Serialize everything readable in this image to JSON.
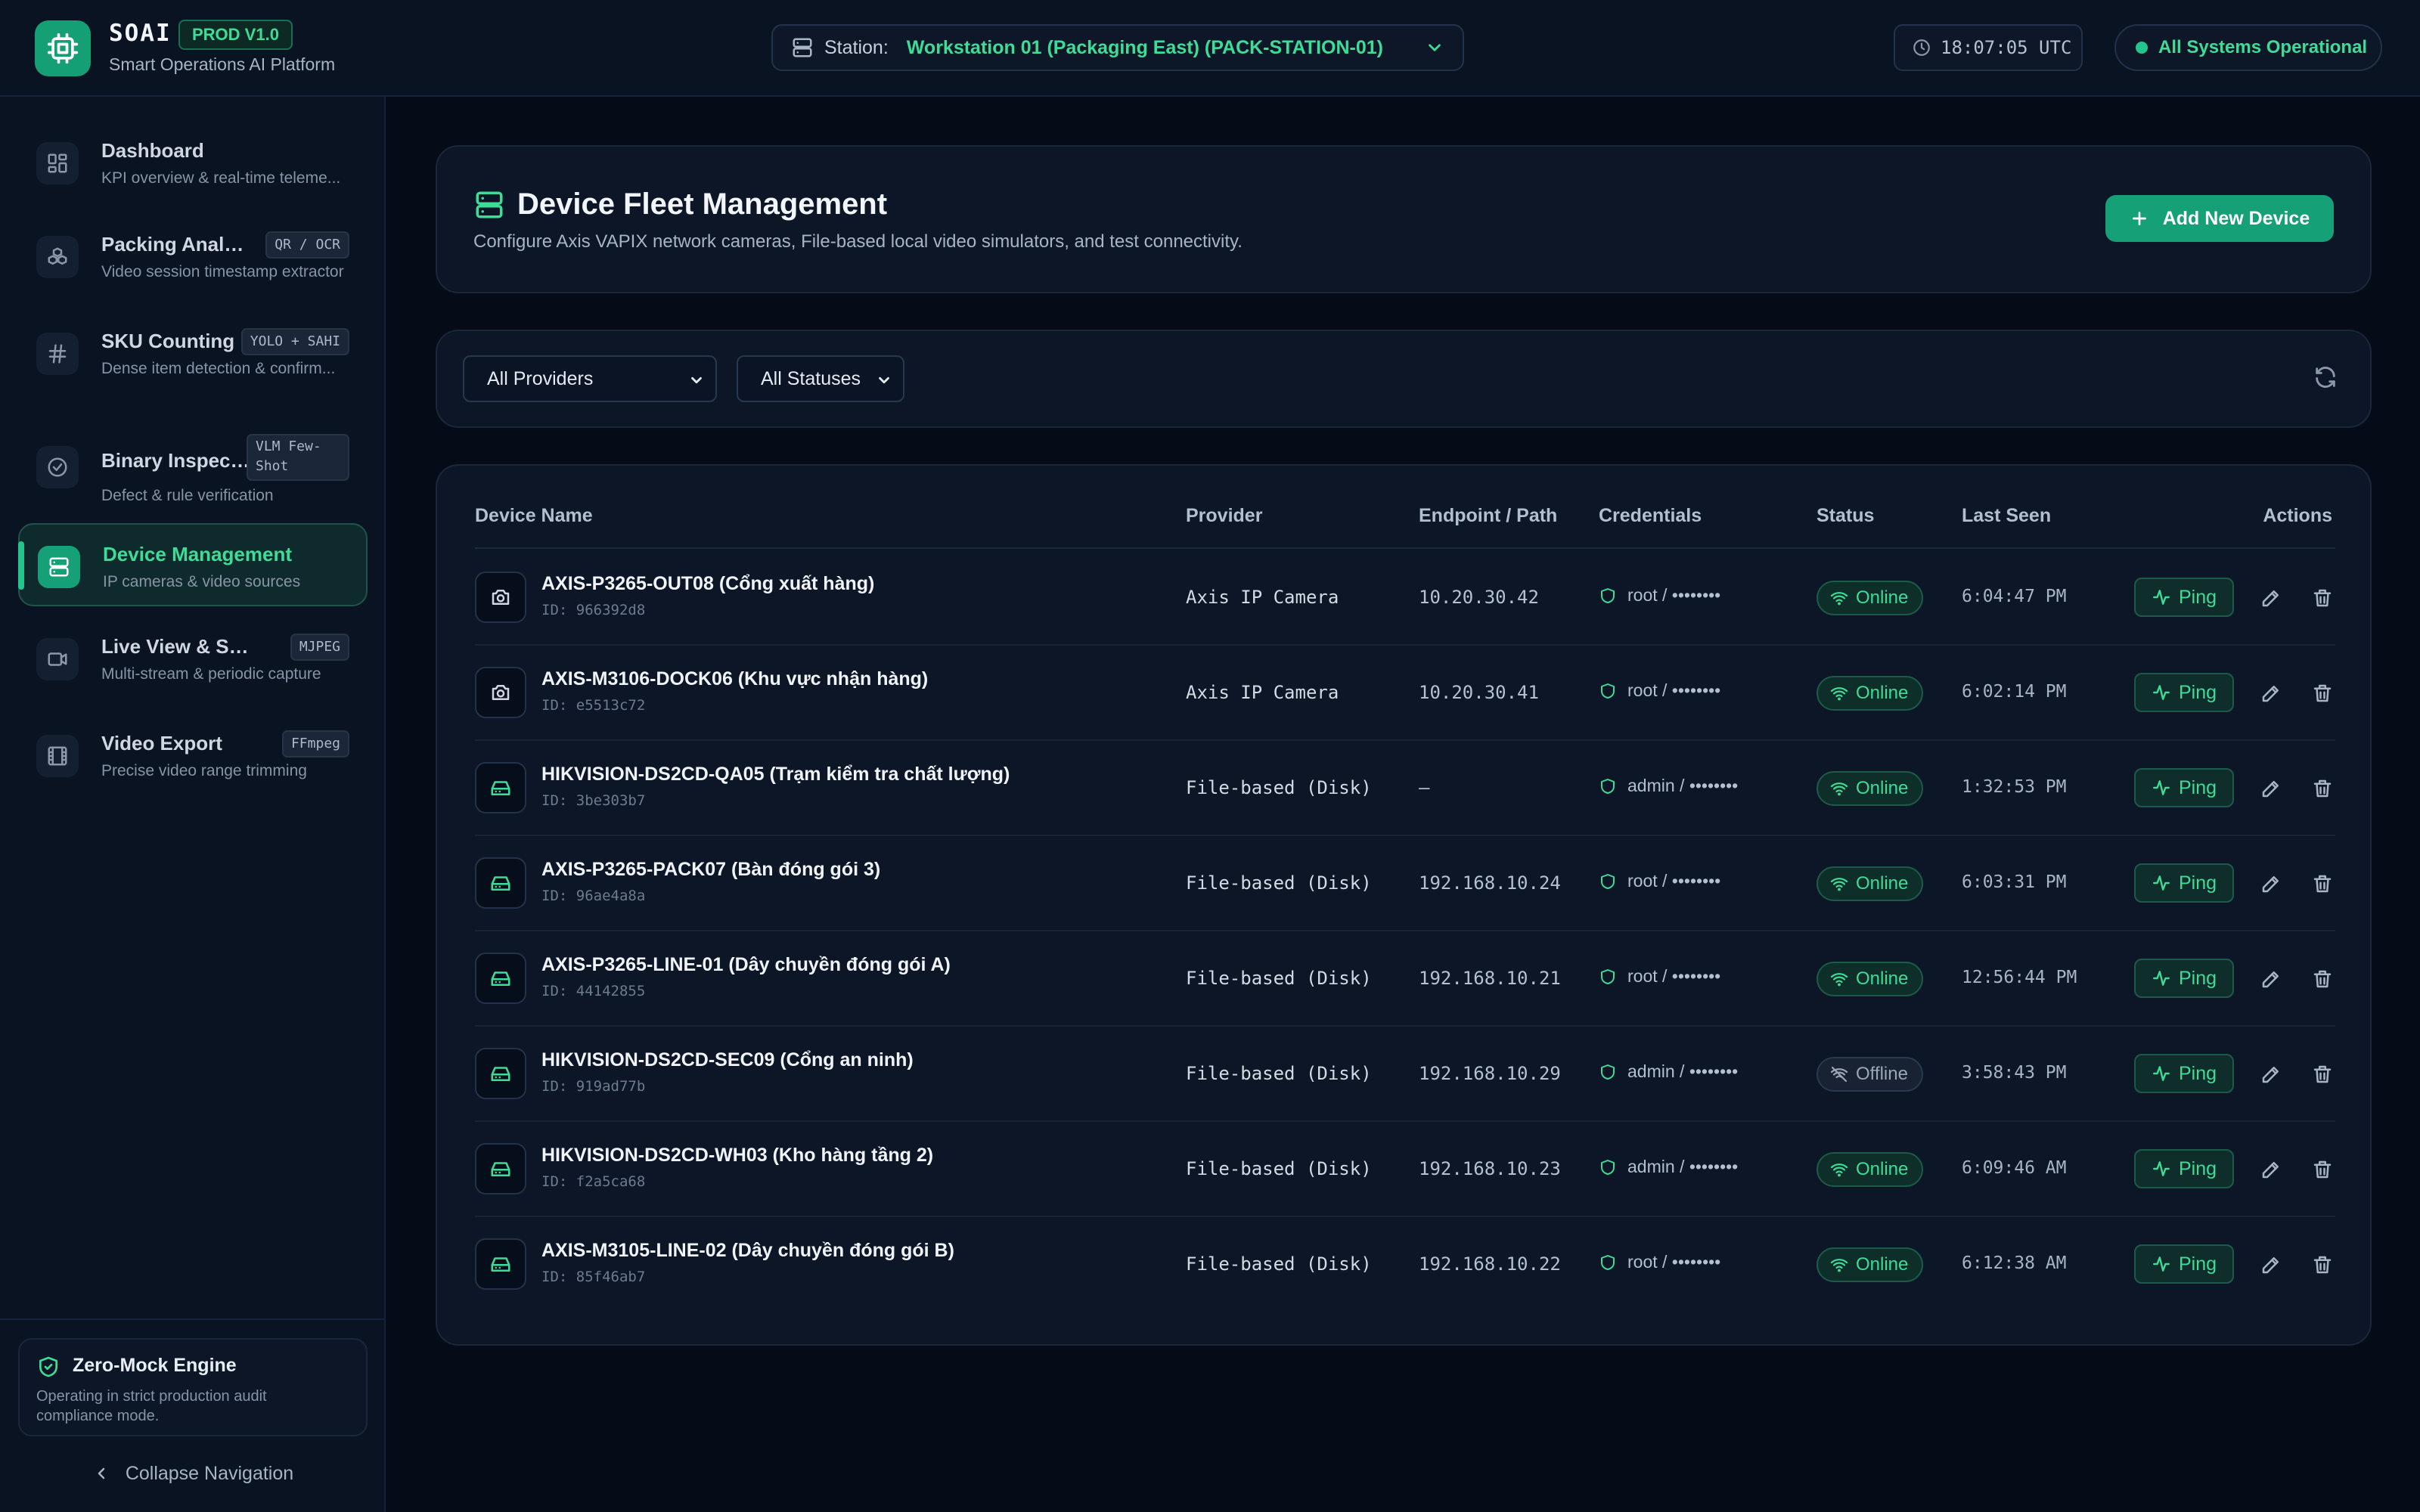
{
  "header": {
    "brand": "SOAI",
    "badge": "PROD V1.0",
    "tagline": "Smart Operations AI Platform",
    "station_label": "Station:",
    "station_value": "Workstation 01 (Packaging East) (PACK-STATION-01)",
    "clock": "18:07:05 UTC",
    "system_status": "All Systems Operational"
  },
  "sidebar": {
    "items": [
      {
        "title": "Dashboard",
        "subtitle": "KPI overview & real-time teleme...",
        "badge": "",
        "icon": "dashboard-grid-icon"
      },
      {
        "title": "Packing Analysis",
        "subtitle": "Video session timestamp extractor",
        "badge": "QR / OCR",
        "icon": "boxes-icon"
      },
      {
        "title": "SKU Counting",
        "subtitle": "Dense item detection & confirm...",
        "badge": "YOLO + SAHI",
        "icon": "hash-icon"
      },
      {
        "title": "Binary Inspect...",
        "subtitle": "Defect & rule verification",
        "badge": "VLM Few-Shot",
        "icon": "check-circle-icon"
      },
      {
        "title": "Device Management",
        "subtitle": "IP cameras & video sources",
        "badge": "",
        "icon": "server-icon"
      },
      {
        "title": "Live View & Snapsh...",
        "subtitle": "Multi-stream & periodic capture",
        "badge": "MJPEG",
        "icon": "video-icon"
      },
      {
        "title": "Video Export",
        "subtitle": "Precise video range trimming",
        "badge": "FFmpeg",
        "icon": "film-icon"
      }
    ],
    "footer": {
      "title": "Zero-Mock Engine",
      "description": "Operating in strict production audit compliance mode.",
      "collapse_label": "Collapse Navigation"
    }
  },
  "main": {
    "title": "Device Fleet Management",
    "description": "Configure Axis VAPIX network cameras, File-based local video simulators, and test connectivity.",
    "add_button": "Add New Device",
    "filters": {
      "provider": "All Providers",
      "status": "All Statuses"
    },
    "table": {
      "headers": [
        "Device Name",
        "Provider",
        "Endpoint / Path",
        "Credentials",
        "Status",
        "Last Seen",
        "Actions"
      ],
      "ping_label": "Ping",
      "rows": [
        {
          "name": "AXIS-P3265-OUT08 (Cổng xuất hàng)",
          "id": "ID: 966392d8",
          "provider": "Axis IP Camera",
          "endpoint": "10.20.30.42",
          "credentials": "root / ••••••••",
          "status": "Online",
          "last_seen": "6:04:47 PM",
          "icon": "camera-icon"
        },
        {
          "name": "AXIS-M3106-DOCK06 (Khu vực nhận hàng)",
          "id": "ID: e5513c72",
          "provider": "Axis IP Camera",
          "endpoint": "10.20.30.41",
          "credentials": "root / ••••••••",
          "status": "Online",
          "last_seen": "6:02:14 PM",
          "icon": "camera-icon"
        },
        {
          "name": "HIKVISION-DS2CD-QA05 (Trạm kiểm tra chất lượng)",
          "id": "ID: 3be303b7",
          "provider": "File-based (Disk)",
          "endpoint": "—",
          "credentials": "admin / ••••••••",
          "status": "Online",
          "last_seen": "1:32:53 PM",
          "icon": "hard-drive-icon"
        },
        {
          "name": "AXIS-P3265-PACK07 (Bàn đóng gói 3)",
          "id": "ID: 96ae4a8a",
          "provider": "File-based (Disk)",
          "endpoint": "192.168.10.24",
          "credentials": "root / ••••••••",
          "status": "Online",
          "last_seen": "6:03:31 PM",
          "icon": "hard-drive-icon"
        },
        {
          "name": "AXIS-P3265-LINE-01 (Dây chuyền đóng gói A)",
          "id": "ID: 44142855",
          "provider": "File-based (Disk)",
          "endpoint": "192.168.10.21",
          "credentials": "root / ••••••••",
          "status": "Online",
          "last_seen": "12:56:44 PM",
          "icon": "hard-drive-icon"
        },
        {
          "name": "HIKVISION-DS2CD-SEC09 (Cổng an ninh)",
          "id": "ID: 919ad77b",
          "provider": "File-based (Disk)",
          "endpoint": "192.168.10.29",
          "credentials": "admin / ••••••••",
          "status": "Offline",
          "last_seen": "3:58:43 PM",
          "icon": "hard-drive-icon"
        },
        {
          "name": "HIKVISION-DS2CD-WH03 (Kho hàng tầng 2)",
          "id": "ID: f2a5ca68",
          "provider": "File-based (Disk)",
          "endpoint": "192.168.10.23",
          "credentials": "admin / ••••••••",
          "status": "Online",
          "last_seen": "6:09:46 AM",
          "icon": "hard-drive-icon"
        },
        {
          "name": "AXIS-M3105-LINE-02 (Dây chuyền đóng gói B)",
          "id": "ID: 85f46ab7",
          "provider": "File-based (Disk)",
          "endpoint": "192.168.10.22",
          "credentials": "root / ••••••••",
          "status": "Online",
          "last_seen": "6:12:38 AM",
          "icon": "hard-drive-icon"
        }
      ]
    }
  },
  "colors": {
    "accent": "#16a078",
    "accent_text": "#3ddc97",
    "background": "#050b17",
    "panel": "#0c1627"
  }
}
